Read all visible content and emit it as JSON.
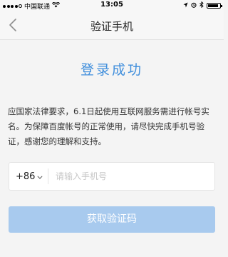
{
  "status_bar": {
    "carrier": "中国联通",
    "wifi_icon": "wifi-icon",
    "time": "13:05",
    "location_icon": "location-arrow-icon",
    "alarm_icon": "alarm-icon",
    "bluetooth_icon": "bluetooth-icon",
    "battery_icon": "battery-icon",
    "battery_level": 0.9,
    "signal_bars_filled": 4,
    "signal_bars_total": 5
  },
  "nav": {
    "back_icon": "chevron-left-icon",
    "title": "验证手机"
  },
  "main": {
    "success_title": "登录成功",
    "notice": "应国家法律要求，6.1日起使用互联网服务需进行帐号实名。为保障百度帐号的正常使用，请尽快完成手机号验证，感谢您的理解和支持。",
    "phone_field": {
      "country_code": "+86",
      "dropdown_icon": "chevron-down-icon",
      "value": "",
      "placeholder": "请输入手机号"
    },
    "submit_label": "获取验证码"
  },
  "colors": {
    "accent": "#3f8edc",
    "button_disabled": "#a8caee",
    "background": "#f4f4f4",
    "placeholder": "#c6c6c6"
  }
}
